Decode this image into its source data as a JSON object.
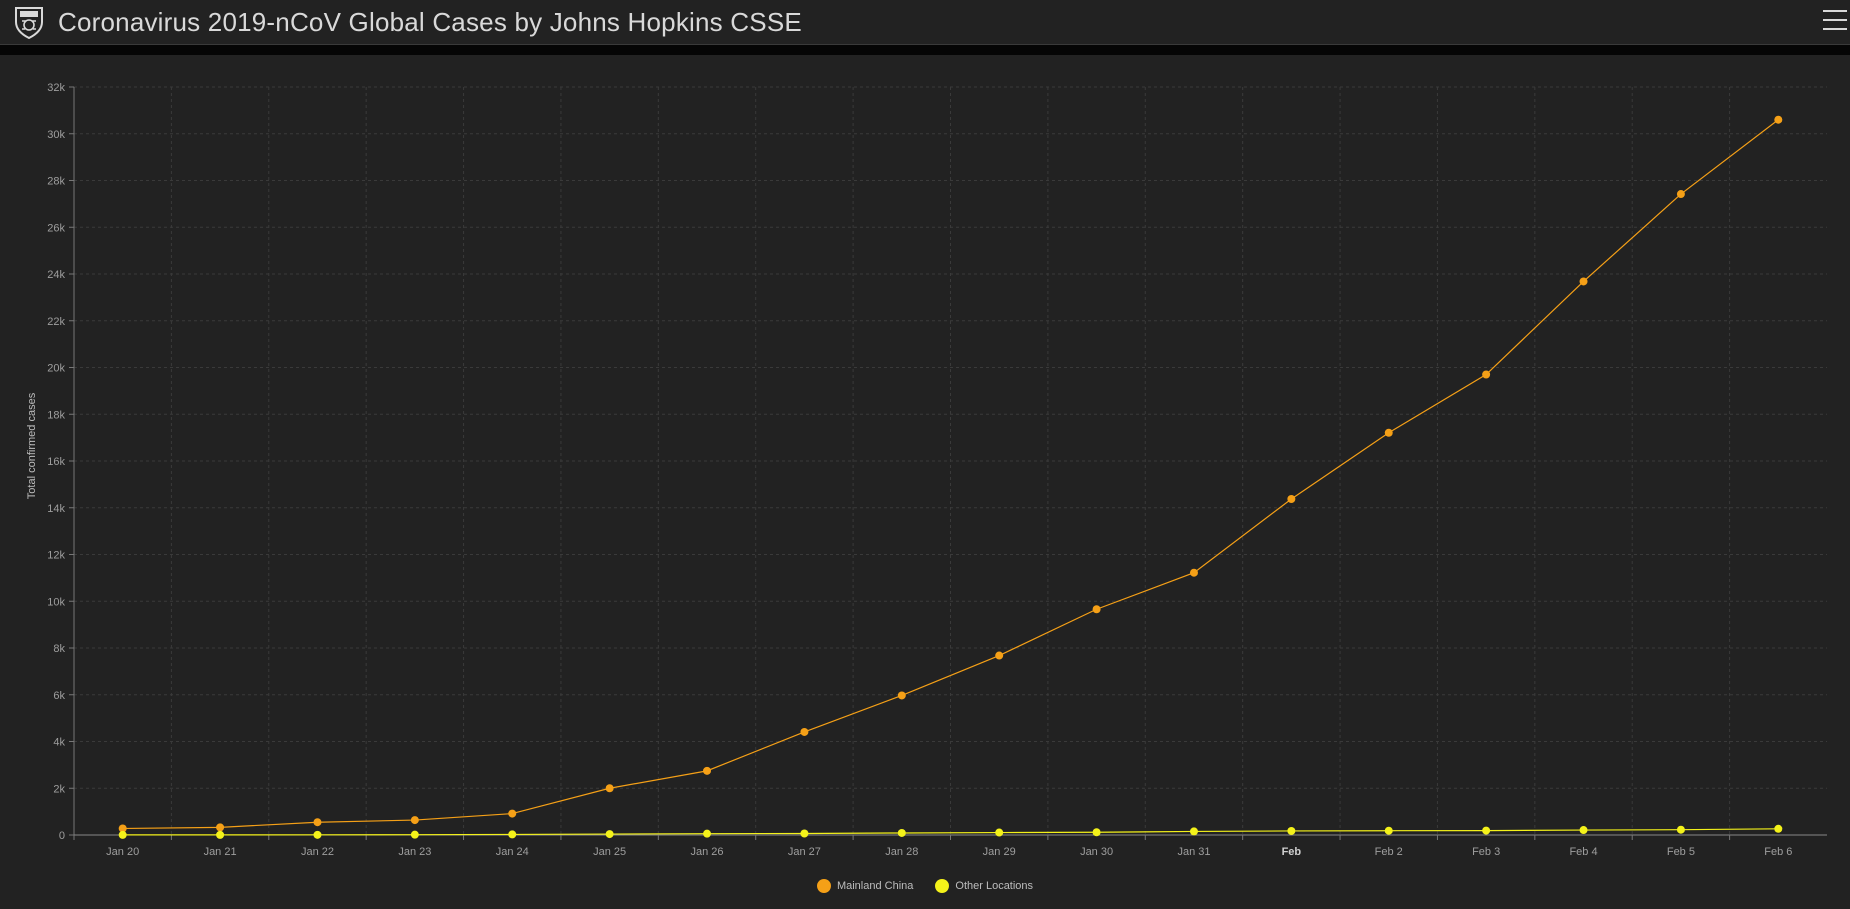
{
  "header": {
    "title": "Coronavirus 2019-nCoV Global Cases by Johns Hopkins CSSE",
    "logo_icon": "university-shield-icon",
    "menu_icon": "hamburger-menu-icon"
  },
  "colors": {
    "background": "#222222",
    "grid": "#3a3a3a",
    "axis_text": "#9e9e9e",
    "mainland_china": "#f5a017",
    "other_locations": "#f4f21a"
  },
  "chart_data": {
    "type": "line",
    "title": "",
    "xlabel": "",
    "ylabel": "Total confirmed cases",
    "categories": [
      "Jan 20",
      "Jan 21",
      "Jan 22",
      "Jan 23",
      "Jan 24",
      "Jan 25",
      "Jan 26",
      "Jan 27",
      "Jan 28",
      "Jan 29",
      "Jan 30",
      "Jan 31",
      "Feb",
      "Feb 2",
      "Feb 3",
      "Feb 4",
      "Feb 5",
      "Feb 6"
    ],
    "bold_categories": [
      "Feb"
    ],
    "ylim": [
      0,
      32000
    ],
    "yticks": [
      0,
      2000,
      4000,
      6000,
      8000,
      10000,
      12000,
      14000,
      16000,
      18000,
      20000,
      22000,
      24000,
      26000,
      28000,
      30000,
      32000
    ],
    "ytick_labels": [
      "0",
      "2k",
      "4k",
      "6k",
      "8k",
      "10k",
      "12k",
      "14k",
      "16k",
      "18k",
      "20k",
      "22k",
      "24k",
      "26k",
      "28k",
      "30k",
      "32k"
    ],
    "grid": true,
    "legend_position": "bottom-center",
    "series": [
      {
        "name": "Mainland China",
        "color": "#f5a017",
        "values": [
          278,
          326,
          547,
          639,
          916,
          2000,
          2744,
          4409,
          5970,
          7678,
          9658,
          11221,
          14375,
          17209,
          19700,
          23680,
          27420,
          30600
        ]
      },
      {
        "name": "Other Locations",
        "color": "#f4f21a",
        "values": [
          4,
          6,
          8,
          14,
          25,
          40,
          57,
          64,
          87,
          105,
          118,
          153,
          173,
          183,
          188,
          212,
          227,
          265
        ]
      }
    ]
  }
}
